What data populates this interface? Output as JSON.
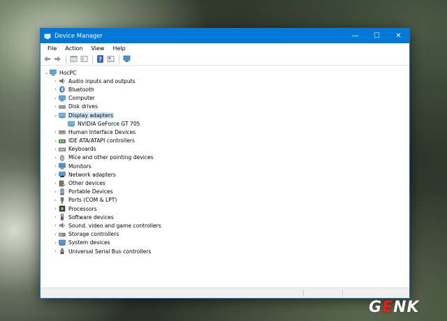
{
  "window": {
    "title": "Device Manager",
    "controls": {
      "minimize": "—",
      "maximize": "☐",
      "close": "✕"
    }
  },
  "menu": [
    "File",
    "Action",
    "View",
    "Help"
  ],
  "toolbar_icons": [
    "back-arrow-icon",
    "forward-arrow-icon",
    "properties-icon",
    "show-hide-tree-icon",
    "help-icon",
    "driver-update-icon",
    "monitor-scan-icon"
  ],
  "tree": {
    "root": "HocPC",
    "categories": [
      {
        "label": "Audio inputs and outputs",
        "icon": "speaker-icon",
        "expanded": false
      },
      {
        "label": "Bluetooth",
        "icon": "bluetooth-icon",
        "expanded": false
      },
      {
        "label": "Computer",
        "icon": "computer-icon",
        "expanded": false
      },
      {
        "label": "Disk drives",
        "icon": "disk-drive-icon",
        "expanded": false
      },
      {
        "label": "Display adapters",
        "icon": "display-adapter-icon",
        "expanded": true,
        "selected": true,
        "children": [
          {
            "label": "NVIDIA GeForce GT 705",
            "icon": "display-adapter-icon"
          }
        ]
      },
      {
        "label": "Human Interface Devices",
        "icon": "hid-icon",
        "expanded": false
      },
      {
        "label": "IDE ATA/ATAPI controllers",
        "icon": "ide-controller-icon",
        "expanded": false
      },
      {
        "label": "Keyboards",
        "icon": "keyboard-icon",
        "expanded": false
      },
      {
        "label": "Mice and other pointing devices",
        "icon": "mouse-icon",
        "expanded": false
      },
      {
        "label": "Monitors",
        "icon": "monitor-icon",
        "expanded": false
      },
      {
        "label": "Network adapters",
        "icon": "network-adapter-icon",
        "expanded": false
      },
      {
        "label": "Other devices",
        "icon": "unknown-device-icon",
        "expanded": false
      },
      {
        "label": "Portable Devices",
        "icon": "portable-device-icon",
        "expanded": false
      },
      {
        "label": "Ports (COM & LPT)",
        "icon": "port-icon",
        "expanded": false
      },
      {
        "label": "Processors",
        "icon": "processor-icon",
        "expanded": false
      },
      {
        "label": "Software devices",
        "icon": "software-device-icon",
        "expanded": false
      },
      {
        "label": "Sound, video and game controllers",
        "icon": "sound-controller-icon",
        "expanded": false
      },
      {
        "label": "Storage controllers",
        "icon": "storage-controller-icon",
        "expanded": false
      },
      {
        "label": "System devices",
        "icon": "system-device-icon",
        "expanded": false
      },
      {
        "label": "Universal Serial Bus controllers",
        "icon": "usb-icon",
        "expanded": false
      }
    ]
  },
  "watermark": {
    "prefix": "G",
    "highlight": "E",
    "suffix": "NK"
  },
  "colors": {
    "titlebar": "#0078d7",
    "selection": "#cce8ff",
    "watermark_red": "#e0231a"
  }
}
